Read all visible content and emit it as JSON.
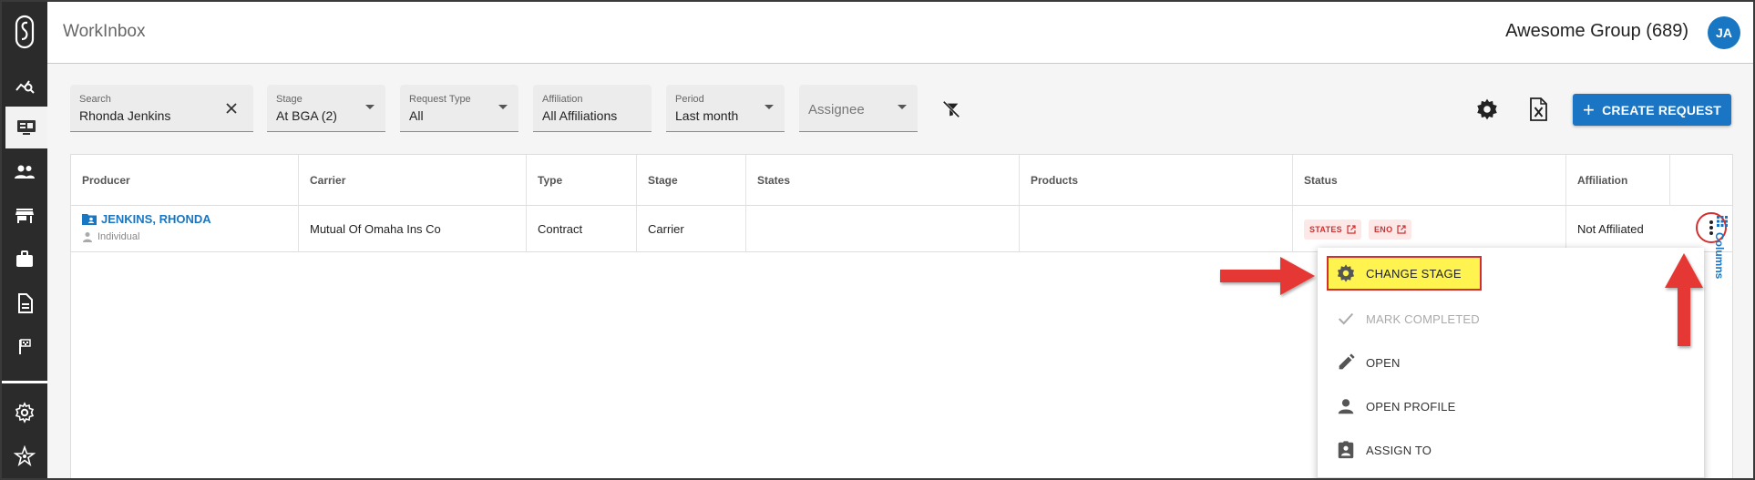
{
  "app": {
    "title": "WorkInbox"
  },
  "header": {
    "group_name": "Awesome Group (689)",
    "avatar_initials": "JA"
  },
  "sidebar": {
    "items": [
      {
        "icon": "logo-icon"
      },
      {
        "icon": "analytics-search-icon"
      },
      {
        "icon": "monitor-icon",
        "active": true
      },
      {
        "icon": "people-icon"
      },
      {
        "icon": "store-icon"
      },
      {
        "icon": "briefcase-icon"
      },
      {
        "icon": "document-icon"
      },
      {
        "icon": "flag-icon"
      },
      {
        "icon": "settings-icon"
      },
      {
        "icon": "star-network-icon"
      }
    ]
  },
  "filters": {
    "search": {
      "label": "Search",
      "value": "Rhonda Jenkins"
    },
    "stage": {
      "label": "Stage",
      "value": "At BGA (2)"
    },
    "request_type": {
      "label": "Request Type",
      "value": "All"
    },
    "affiliation": {
      "label": "Affiliation",
      "value": "All Affiliations"
    },
    "period": {
      "label": "Period",
      "value": "Last month"
    },
    "assignee": {
      "placeholder": "Assignee"
    }
  },
  "toolbar": {
    "create_label": "CREATE REQUEST"
  },
  "table": {
    "headers": [
      "Producer",
      "Carrier",
      "Type",
      "Stage",
      "States",
      "Products",
      "Status",
      "Affiliation"
    ],
    "rows": [
      {
        "producer_name": "JENKINS, RHONDA",
        "producer_type": "Individual",
        "carrier": "Mutual Of Omaha Ins Co",
        "type": "Contract",
        "stage": "Carrier",
        "states": "",
        "products": "",
        "status_chips": [
          "STATES",
          "ENO"
        ],
        "affiliation": "Not Affiliated"
      }
    ]
  },
  "columns_tab": {
    "label": "Columns"
  },
  "menu": {
    "items": [
      {
        "label": "CHANGE STAGE",
        "icon": "gear-icon",
        "highlighted": true
      },
      {
        "label": "MARK COMPLETED",
        "icon": "check-icon",
        "disabled": true
      },
      {
        "label": "OPEN",
        "icon": "pencil-icon"
      },
      {
        "label": "OPEN PROFILE",
        "icon": "person-icon"
      },
      {
        "label": "ASSIGN TO",
        "icon": "assignment-ind-icon"
      }
    ]
  },
  "colors": {
    "primary": "#1a76c4",
    "sidebar": "#2b2b2b",
    "annotation_red": "#e53935",
    "highlight_yellow": "#fff44f",
    "chip_red": "#d32f2f"
  }
}
